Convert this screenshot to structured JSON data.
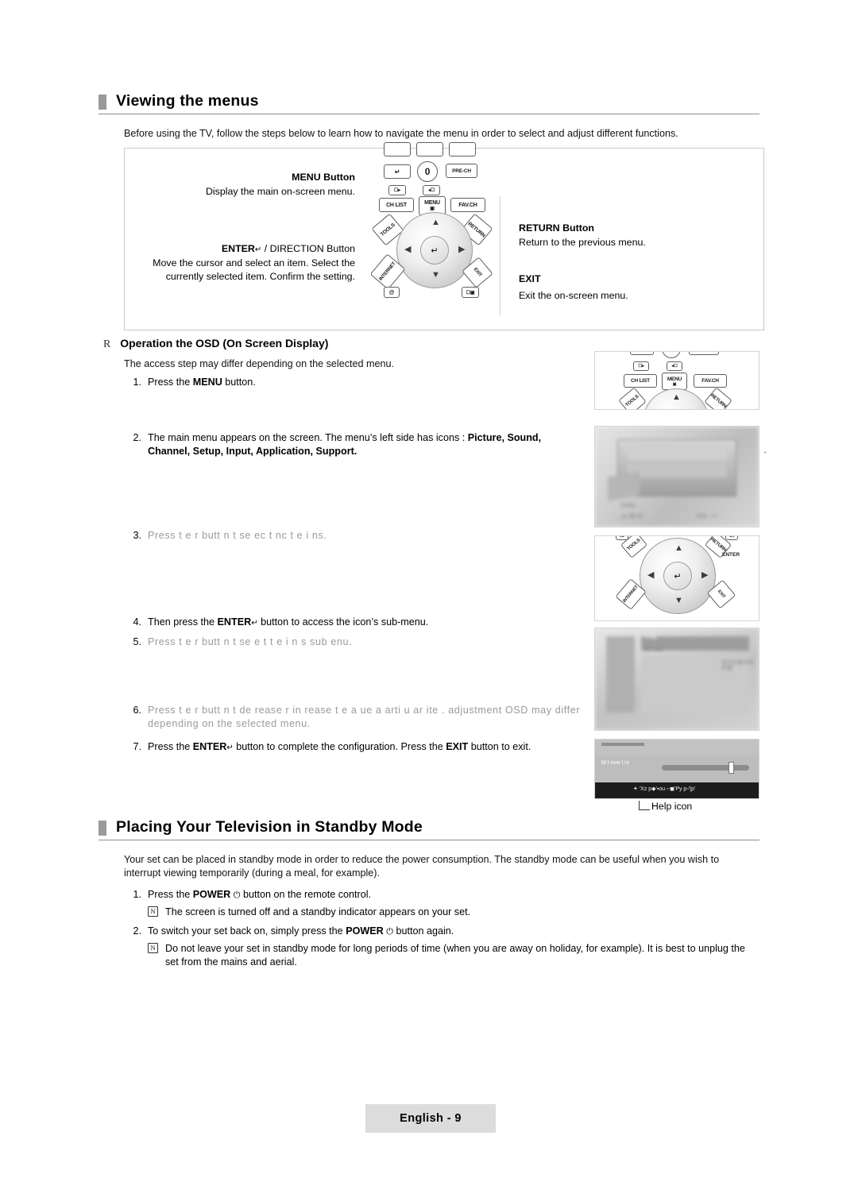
{
  "sections": {
    "viewing": {
      "title": "Viewing the menus",
      "intro": "Before using the TV, follow the steps below to learn how to navigate the menu in order to select and adjust different functions."
    },
    "standby": {
      "title": "Placing Your Television in Standby Mode",
      "intro": "Your set can be placed in standby mode in order to reduce the power consumption. The standby mode can be useful when you wish to interrupt viewing temporarily (during a meal, for example)."
    }
  },
  "diagram": {
    "menu_label": "MENU Button",
    "menu_desc": "Display the main on-screen menu.",
    "enter_label_a": "ENTER",
    "enter_label_b": " / DIRECTION Button",
    "enter_desc": "Move the cursor and select an item. Select the currently selected item. Confirm the setting.",
    "return_label": "RETURN Button",
    "return_desc": "Return to the previous menu.",
    "exit_label": "EXIT",
    "exit_desc": "Exit the on-screen menu.",
    "keys": {
      "pre_ch": "PRE-CH",
      "zero": "0",
      "ch_list": "CH LIST",
      "menu": "MENU",
      "fav_ch": "FAV.CH",
      "tools": "TOOLS",
      "return": "RETURN",
      "internet": "INTERNET",
      "exit": "EXIT",
      "enter": "ENTER",
      "at": "@"
    }
  },
  "osd": {
    "heading_bullet": "R",
    "heading": "Operation the OSD (On Screen Display)",
    "note": "The access step may differ depending on the selected menu.",
    "steps": [
      {
        "n": "1.",
        "text": "Press the MENU button.",
        "bold": [
          "MENU"
        ]
      },
      {
        "n": "2.",
        "text": "The main menu appears on the screen. The menu’s left side has icons : Picture, Sound, Channel, Setup, Input, Application, Support."
      },
      {
        "n": "3.",
        "text": "Press t e    r  butt  n t  se ec t  nc     t  e i    ns."
      },
      {
        "n": "4.",
        "text": "Then press the ENTER  button to access the icon’s sub-menu."
      },
      {
        "n": "5.",
        "text": "Press t e    r  butt  n t  se e t t e i   n s sub  enu."
      },
      {
        "n": "6.",
        "text": "Press t e    r  butt  n t  de  rease  r in  rease t e  a  ue    a  arti u ar ite  . adjustment OSD may differ depending on the selected menu."
      },
      {
        "n": "7.",
        "text": "Press the ENTER  button to complete the configuration. Press the EXIT button to exit."
      }
    ],
    "help_icon_caption": "Help icon"
  },
  "standby_steps": [
    {
      "n": "1.",
      "text": "Press the POWER   button on the remote control."
    },
    {
      "n": "2.",
      "text": "To switch your set back on, simply press the POWER   button again."
    }
  ],
  "standby_notes": [
    "The screen is turned off and a standby indicator appears on your set.",
    "Do not leave your set in standby mode for long periods of time (when you are away on holiday, for example). It is best to unplug the set from the mains and aerial."
  ],
  "note_icon": "N",
  "footer": "English - 9",
  "thumb_text": {
    "t2_a": "Xrosa",
    "t2_b": "_ty '3R |4'",
    "t2_c": "E'R⌐ ⌐l⌐'",
    "t4_title": "Xrog'",
    "t4_sub": "M l nvw",
    "t4_rows": "E'D  E'@  E'B  E'@",
    "t5_bar": "M l nvw l rs",
    "t5_foot": "✦ 'Xz p◆'▪ᴏu ⌐◼'Py p▫'|p'"
  },
  "colors": {
    "head_bar": "#9a9a9a",
    "rule": "#8d8d8d",
    "footer_bg": "#dcdcdc",
    "text": "#121212",
    "faded": "#9a9a9a"
  }
}
